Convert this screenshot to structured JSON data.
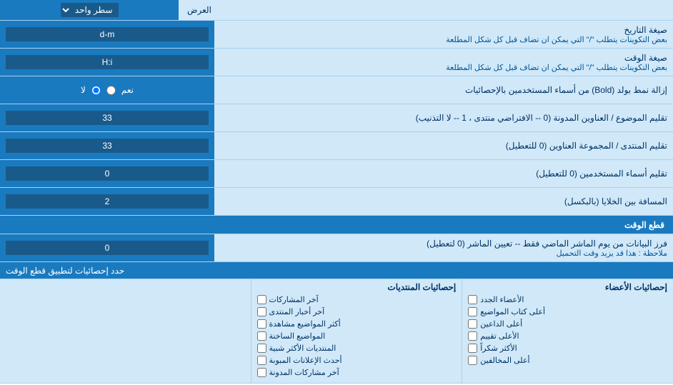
{
  "page": {
    "title": "العرض",
    "dropdown_label": "سطر واحد",
    "rows": [
      {
        "id": "date_format",
        "right_label": "صيغة التاريخ",
        "right_sublabel": "بعض التكوينات يتطلب \"/\" التي يمكن ان تضاف قبل كل شكل المطلعة",
        "left_value": "d-m",
        "type": "input"
      },
      {
        "id": "time_format",
        "right_label": "صيغة الوقت",
        "right_sublabel": "بعض التكوينات يتطلب \"/\" التي يمكن ان تضاف قبل كل شكل المطلعة",
        "left_value": "H:i",
        "type": "input"
      },
      {
        "id": "bold_removal",
        "right_label": "إزالة نمط بولد (Bold) من أسماء المستخدمين بالإحصائيات",
        "left_value_yes": "نعم",
        "left_value_no": "لا",
        "type": "radio"
      },
      {
        "id": "topic_address",
        "right_label": "تقليم الموضوع / العناوين المدونة (0 -- الافتراضي منتدى ، 1 -- لا التذنيب)",
        "left_value": "33",
        "type": "input"
      },
      {
        "id": "forum_address",
        "right_label": "تقليم المنتدى / المجموعة العناوين (0 للتعطيل)",
        "left_value": "33",
        "type": "input"
      },
      {
        "id": "user_names",
        "right_label": "تقليم أسماء المستخدمين (0 للتعطيل)",
        "left_value": "0",
        "type": "input"
      },
      {
        "id": "cell_spacing",
        "right_label": "المسافة بين الخلايا (بالبكسل)",
        "left_value": "2",
        "type": "input"
      }
    ],
    "section_time_cut": {
      "header": "قطع الوقت",
      "row": {
        "right_label": "فرز البيانات من يوم الماشر الماضي فقط -- تعيين الماشر (0 لتعطيل)",
        "right_note": "ملاحظة : هذا قد يزيد وقت التحميل",
        "left_value": "0"
      }
    },
    "checkboxes_section": {
      "header_label": "حدد إحصائيات لتطبيق قطع الوقت",
      "col1_header": "إحصائيات الأعضاء",
      "col2_header": "إحصائيات المنتديات",
      "col1_items": [
        "الأعضاء الجدد",
        "أعلى كتاب المواضيع",
        "أعلى الداعين",
        "الأعلى تقييم",
        "الأكثر شكراً",
        "أعلى المخالفين"
      ],
      "col2_items": [
        "آخر المشاركات",
        "آخر أخبار المنتدى",
        "أكثر المواضيع مشاهدة",
        "المواضيع الساخنة",
        "المنتديات الأكثر شبية",
        "أحدث الإعلانات المبوبة",
        "آخر مشاركات المدونة"
      ]
    }
  },
  "colors": {
    "blue_dark": "#1a5a8a",
    "blue_mid": "#1a7abf",
    "blue_light": "#d0e8f8",
    "text_dark": "#003366",
    "text_white": "#ffffff"
  }
}
